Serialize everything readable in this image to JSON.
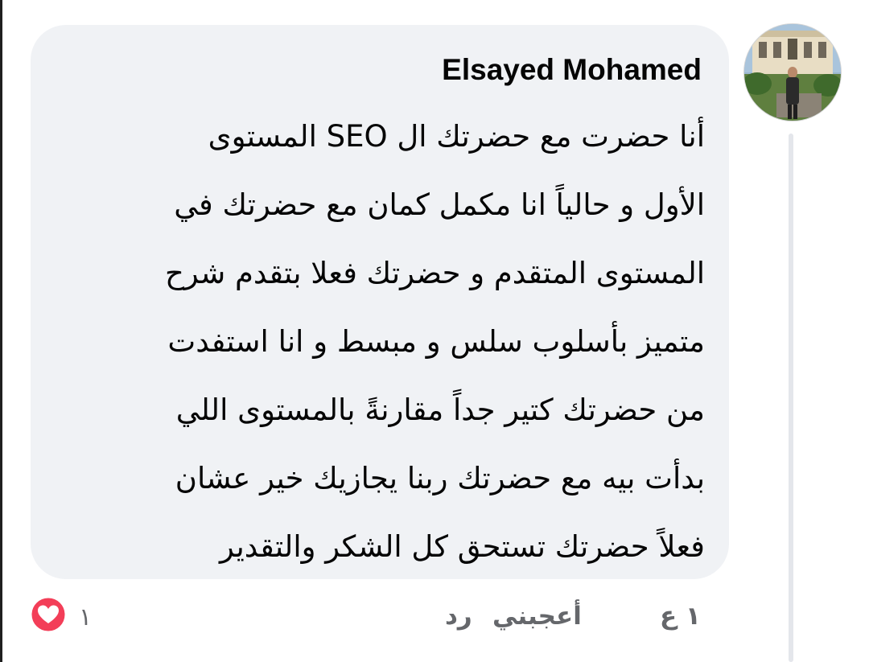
{
  "comment": {
    "author": "Elsayed Mohamed",
    "lines": [
      "أنا حضرت مع حضرتك ال SEO المستوى",
      "الأول و حالياً انا مكمل كمان مع حضرتك في",
      "المستوى المتقدم و حضرتك فعلا بتقدم شرح",
      "متميز بأسلوب سلس  و مبسط و انا استفدت",
      "من حضرتك كتير جداً مقارنةً بالمستوى اللي",
      "بدأت بيه مع حضرتك ربنا يجازيك خير عشان",
      "فعلاً حضرتك تستحق كل الشكر والتقدير"
    ]
  },
  "actions": {
    "time": "١ ع",
    "like": "أعجبني",
    "reply": "رد"
  },
  "reactions": {
    "icon": "heart-icon",
    "count": "١",
    "color": "#f33e58"
  },
  "colors": {
    "bubble": "#f0f2f5",
    "text": "#050505",
    "meta": "#65676b",
    "thread_line": "#e4e6eb"
  }
}
